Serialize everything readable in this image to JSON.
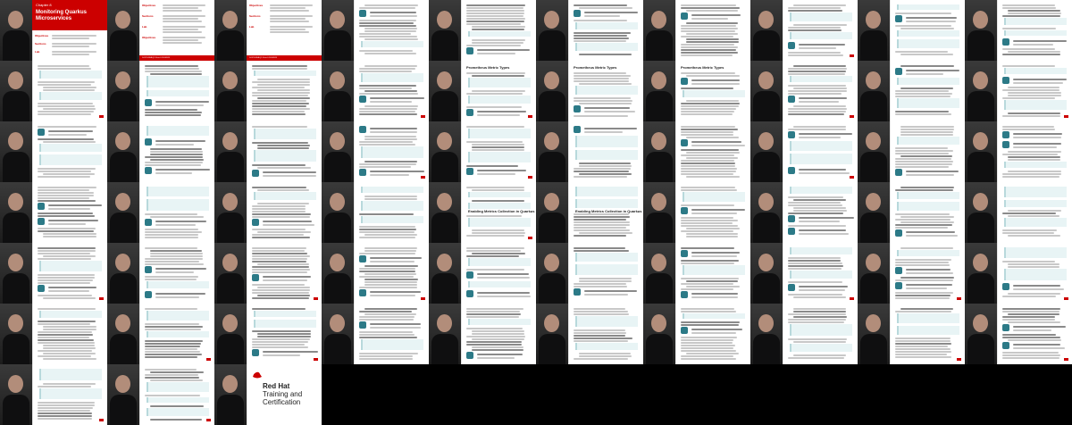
{
  "chapter": {
    "number_label": "Chapter 8",
    "title": "Monitoring Quarkus Microservices",
    "outline_rows": [
      "Objectives",
      "Sections",
      "Lab"
    ],
    "footer": "DO378-RHBQ2.13-en-2-20240528"
  },
  "sections": {
    "metric_types": "Prometheus Metric Types",
    "enabling": "Enabling Metrics Collection in Quarkus"
  },
  "branding": {
    "line1": "Red Hat",
    "line2": "Training and",
    "line3": "Certification",
    "accent": "#cc0000"
  },
  "layout_info": {
    "columns": 10,
    "rows": 7,
    "filled_tiles": 63
  }
}
